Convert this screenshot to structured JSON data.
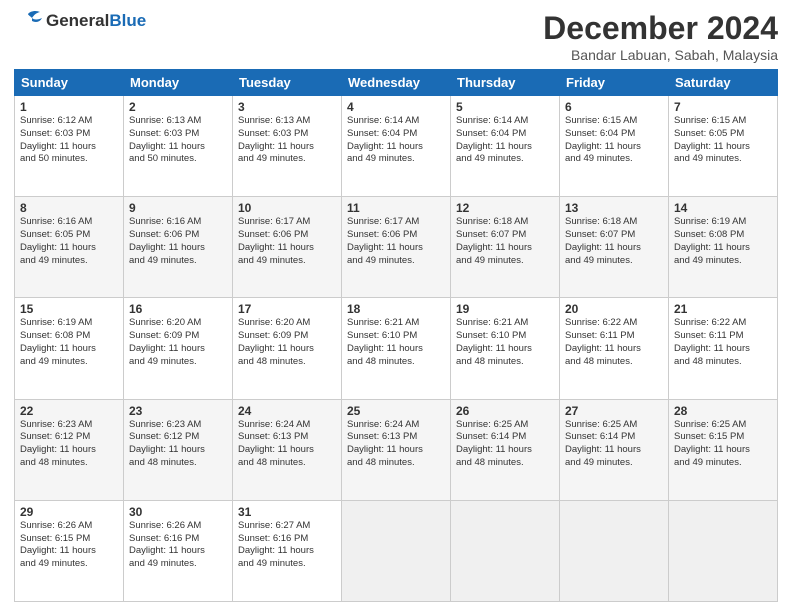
{
  "header": {
    "logo_general": "General",
    "logo_blue": "Blue",
    "month_title": "December 2024",
    "location": "Bandar Labuan, Sabah, Malaysia"
  },
  "days_of_week": [
    "Sunday",
    "Monday",
    "Tuesday",
    "Wednesday",
    "Thursday",
    "Friday",
    "Saturday"
  ],
  "weeks": [
    [
      {
        "num": "1",
        "info": "Sunrise: 6:12 AM\nSunset: 6:03 PM\nDaylight: 11 hours\nand 50 minutes."
      },
      {
        "num": "2",
        "info": "Sunrise: 6:13 AM\nSunset: 6:03 PM\nDaylight: 11 hours\nand 50 minutes."
      },
      {
        "num": "3",
        "info": "Sunrise: 6:13 AM\nSunset: 6:03 PM\nDaylight: 11 hours\nand 49 minutes."
      },
      {
        "num": "4",
        "info": "Sunrise: 6:14 AM\nSunset: 6:04 PM\nDaylight: 11 hours\nand 49 minutes."
      },
      {
        "num": "5",
        "info": "Sunrise: 6:14 AM\nSunset: 6:04 PM\nDaylight: 11 hours\nand 49 minutes."
      },
      {
        "num": "6",
        "info": "Sunrise: 6:15 AM\nSunset: 6:04 PM\nDaylight: 11 hours\nand 49 minutes."
      },
      {
        "num": "7",
        "info": "Sunrise: 6:15 AM\nSunset: 6:05 PM\nDaylight: 11 hours\nand 49 minutes."
      }
    ],
    [
      {
        "num": "8",
        "info": "Sunrise: 6:16 AM\nSunset: 6:05 PM\nDaylight: 11 hours\nand 49 minutes."
      },
      {
        "num": "9",
        "info": "Sunrise: 6:16 AM\nSunset: 6:06 PM\nDaylight: 11 hours\nand 49 minutes."
      },
      {
        "num": "10",
        "info": "Sunrise: 6:17 AM\nSunset: 6:06 PM\nDaylight: 11 hours\nand 49 minutes."
      },
      {
        "num": "11",
        "info": "Sunrise: 6:17 AM\nSunset: 6:06 PM\nDaylight: 11 hours\nand 49 minutes."
      },
      {
        "num": "12",
        "info": "Sunrise: 6:18 AM\nSunset: 6:07 PM\nDaylight: 11 hours\nand 49 minutes."
      },
      {
        "num": "13",
        "info": "Sunrise: 6:18 AM\nSunset: 6:07 PM\nDaylight: 11 hours\nand 49 minutes."
      },
      {
        "num": "14",
        "info": "Sunrise: 6:19 AM\nSunset: 6:08 PM\nDaylight: 11 hours\nand 49 minutes."
      }
    ],
    [
      {
        "num": "15",
        "info": "Sunrise: 6:19 AM\nSunset: 6:08 PM\nDaylight: 11 hours\nand 49 minutes."
      },
      {
        "num": "16",
        "info": "Sunrise: 6:20 AM\nSunset: 6:09 PM\nDaylight: 11 hours\nand 49 minutes."
      },
      {
        "num": "17",
        "info": "Sunrise: 6:20 AM\nSunset: 6:09 PM\nDaylight: 11 hours\nand 48 minutes."
      },
      {
        "num": "18",
        "info": "Sunrise: 6:21 AM\nSunset: 6:10 PM\nDaylight: 11 hours\nand 48 minutes."
      },
      {
        "num": "19",
        "info": "Sunrise: 6:21 AM\nSunset: 6:10 PM\nDaylight: 11 hours\nand 48 minutes."
      },
      {
        "num": "20",
        "info": "Sunrise: 6:22 AM\nSunset: 6:11 PM\nDaylight: 11 hours\nand 48 minutes."
      },
      {
        "num": "21",
        "info": "Sunrise: 6:22 AM\nSunset: 6:11 PM\nDaylight: 11 hours\nand 48 minutes."
      }
    ],
    [
      {
        "num": "22",
        "info": "Sunrise: 6:23 AM\nSunset: 6:12 PM\nDaylight: 11 hours\nand 48 minutes."
      },
      {
        "num": "23",
        "info": "Sunrise: 6:23 AM\nSunset: 6:12 PM\nDaylight: 11 hours\nand 48 minutes."
      },
      {
        "num": "24",
        "info": "Sunrise: 6:24 AM\nSunset: 6:13 PM\nDaylight: 11 hours\nand 48 minutes."
      },
      {
        "num": "25",
        "info": "Sunrise: 6:24 AM\nSunset: 6:13 PM\nDaylight: 11 hours\nand 48 minutes."
      },
      {
        "num": "26",
        "info": "Sunrise: 6:25 AM\nSunset: 6:14 PM\nDaylight: 11 hours\nand 48 minutes."
      },
      {
        "num": "27",
        "info": "Sunrise: 6:25 AM\nSunset: 6:14 PM\nDaylight: 11 hours\nand 49 minutes."
      },
      {
        "num": "28",
        "info": "Sunrise: 6:25 AM\nSunset: 6:15 PM\nDaylight: 11 hours\nand 49 minutes."
      }
    ],
    [
      {
        "num": "29",
        "info": "Sunrise: 6:26 AM\nSunset: 6:15 PM\nDaylight: 11 hours\nand 49 minutes."
      },
      {
        "num": "30",
        "info": "Sunrise: 6:26 AM\nSunset: 6:16 PM\nDaylight: 11 hours\nand 49 minutes."
      },
      {
        "num": "31",
        "info": "Sunrise: 6:27 AM\nSunset: 6:16 PM\nDaylight: 11 hours\nand 49 minutes."
      },
      {
        "num": "",
        "info": ""
      },
      {
        "num": "",
        "info": ""
      },
      {
        "num": "",
        "info": ""
      },
      {
        "num": "",
        "info": ""
      }
    ]
  ]
}
